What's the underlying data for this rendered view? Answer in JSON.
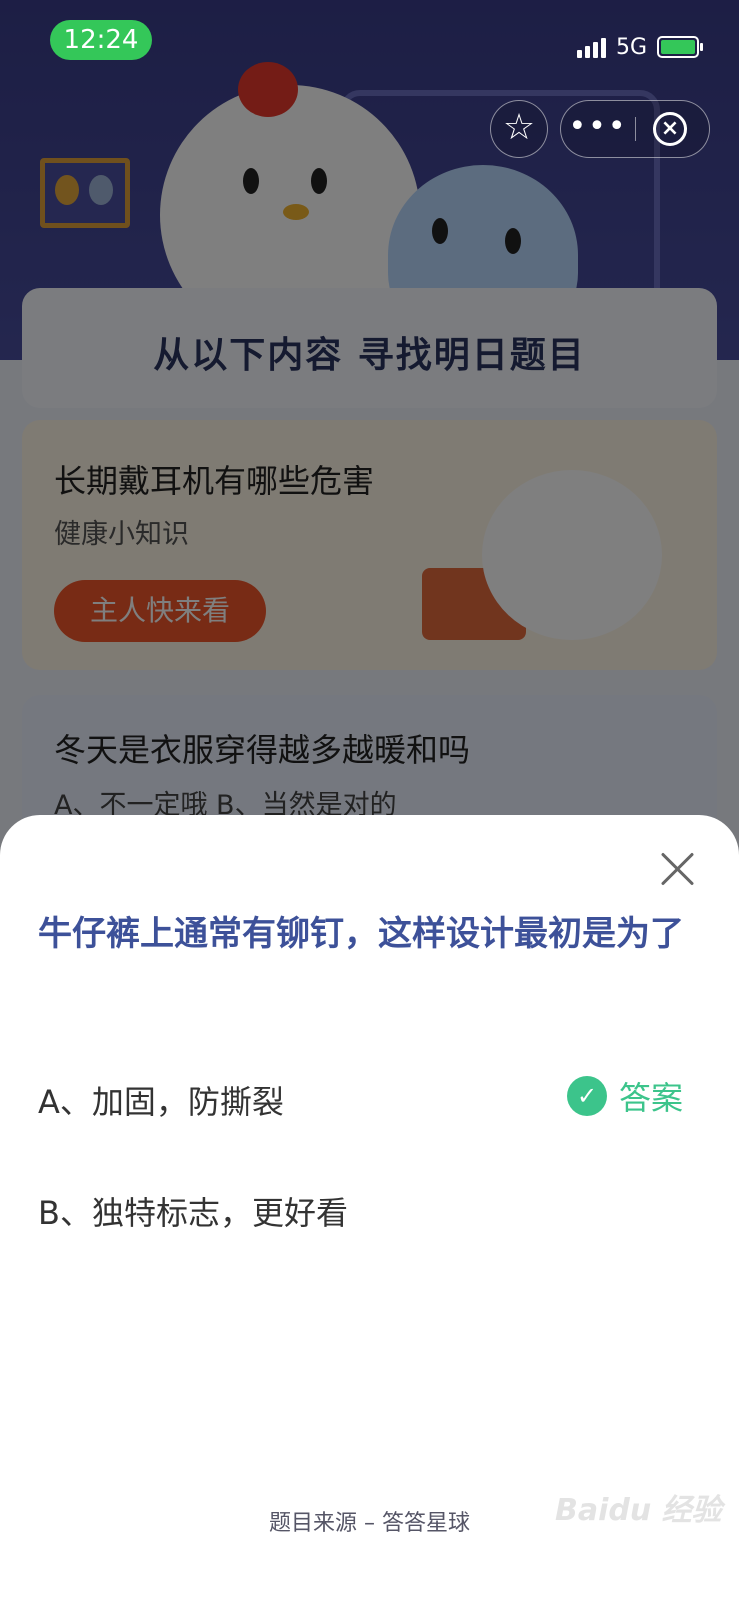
{
  "status_bar": {
    "time": "12:24",
    "network": "5G",
    "battery_charging": true,
    "accent_color": "#34c759"
  },
  "capsule": {
    "favorite_icon": "star-icon",
    "more_icon": "more-icon",
    "more_label": "•••",
    "close_icon": "close-icon"
  },
  "background": {
    "headline": "从以下内容 寻找明日题目",
    "news_card": {
      "title": "长期戴耳机有哪些危害",
      "subtitle": "健康小知识",
      "button_label": "主人快来看"
    },
    "quiz_card": {
      "title": "冬天是衣服穿得越多越暖和吗",
      "options": "A、不一定哦     B、当然是对的"
    }
  },
  "sheet": {
    "question": "牛仔裤上通常有铆钉，这样设计最初是为了",
    "options": [
      {
        "label": "A、加固，防撕裂",
        "is_answer": true
      },
      {
        "label": "B、独特标志，更好看",
        "is_answer": false
      }
    ],
    "answer_label": "答案",
    "answer_color": "#3cc48b",
    "source": "题目来源 – 答答星球",
    "watermark": "Baidu 经验"
  }
}
